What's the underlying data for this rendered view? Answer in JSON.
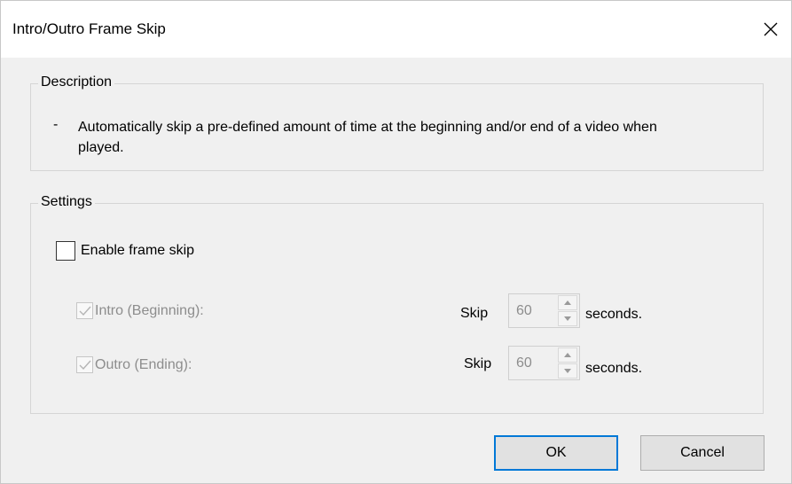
{
  "window": {
    "title": "Intro/Outro Frame Skip",
    "close_icon": "close-icon"
  },
  "description": {
    "group_label": "Description",
    "dash": "-",
    "text": "Automatically skip a pre-defined amount of time at the beginning and/or end of a video when played."
  },
  "settings": {
    "group_label": "Settings",
    "enable": {
      "label": "Enable frame skip",
      "checked": false
    },
    "intro": {
      "label": "Intro (Beginning):",
      "checked": true,
      "enabled": false,
      "skip_label": "Skip",
      "value": "60",
      "unit": "seconds."
    },
    "outro": {
      "label": "Outro (Ending):",
      "checked": true,
      "enabled": false,
      "skip_label": "Skip",
      "value": "60",
      "unit": "seconds."
    }
  },
  "buttons": {
    "ok": "OK",
    "cancel": "Cancel"
  },
  "colors": {
    "dialog_bg": "#f0f0f0",
    "titlebar_bg": "#ffffff",
    "focus_border": "#0078d7",
    "disabled_text": "#8d8d8d"
  }
}
